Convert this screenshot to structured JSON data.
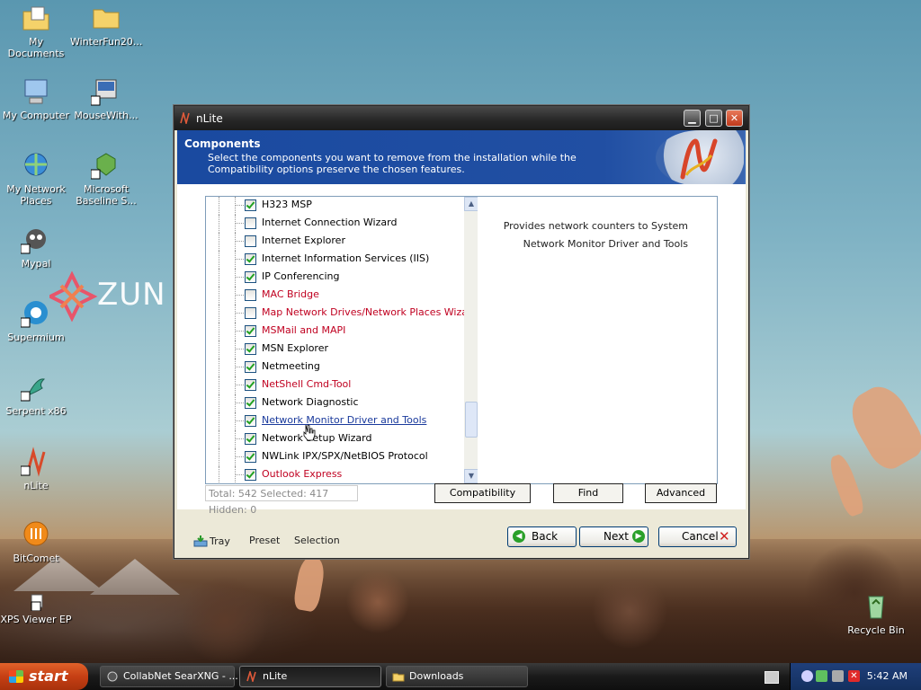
{
  "desktop": {
    "icons": [
      {
        "label": "My Documents",
        "icon": "folder-docs-icon"
      },
      {
        "label": "WinterFun20...",
        "icon": "folder-icon"
      },
      {
        "label": "My Computer",
        "icon": "computer-icon"
      },
      {
        "label": "MouseWith...",
        "icon": "program-icon"
      },
      {
        "label": "My Network Places",
        "icon": "network-icon"
      },
      {
        "label": "Microsoft Baseline S...",
        "icon": "mbsa-icon"
      },
      {
        "label": "Mypal",
        "icon": "mypal-icon"
      },
      {
        "label": "Supermium",
        "icon": "supermium-icon"
      },
      {
        "label": "Serpent x86",
        "icon": "serpent-icon"
      },
      {
        "label": "nLite",
        "icon": "nlite-icon"
      },
      {
        "label": "BitComet",
        "icon": "bitcomet-icon"
      },
      {
        "label": "XPS Viewer EP",
        "icon": "xps-icon"
      },
      {
        "label": "Recycle Bin",
        "icon": "recycle-bin-icon"
      }
    ],
    "wallpaper_brand": "ZUN"
  },
  "window": {
    "title": "nLite",
    "header_title": "Components",
    "header_desc": "Select the components you want to remove from the installation while the Compatibility options preserve the chosen features.",
    "tree_items": [
      {
        "label": "H323 MSP",
        "checked": true,
        "style": "normal"
      },
      {
        "label": "Internet Connection Wizard",
        "checked": false,
        "style": "normal"
      },
      {
        "label": "Internet Explorer",
        "checked": false,
        "style": "normal"
      },
      {
        "label": "Internet Information Services (IIS)",
        "checked": true,
        "style": "normal"
      },
      {
        "label": "IP Conferencing",
        "checked": true,
        "style": "normal"
      },
      {
        "label": "MAC Bridge",
        "checked": false,
        "style": "red"
      },
      {
        "label": "Map Network Drives/Network Places Wizard",
        "checked": false,
        "style": "red"
      },
      {
        "label": "MSMail and MAPI",
        "checked": true,
        "style": "red"
      },
      {
        "label": "MSN Explorer",
        "checked": true,
        "style": "normal"
      },
      {
        "label": "Netmeeting",
        "checked": true,
        "style": "normal"
      },
      {
        "label": "NetShell Cmd-Tool",
        "checked": true,
        "style": "red"
      },
      {
        "label": "Network Diagnostic",
        "checked": true,
        "style": "normal"
      },
      {
        "label": "Network Monitor Driver and Tools",
        "checked": true,
        "style": "link"
      },
      {
        "label": "Network Setup Wizard",
        "checked": true,
        "style": "normal"
      },
      {
        "label": "NWLink IPX/SPX/NetBIOS Protocol",
        "checked": true,
        "style": "normal"
      },
      {
        "label": "Outlook Express",
        "checked": true,
        "style": "red"
      }
    ],
    "description_lines": [
      "Provides network counters to System",
      "Network Monitor Driver and Tools"
    ],
    "status": "Total: 542 Selected: 417 Hidden: 0",
    "compatibility_label": "Compatibility",
    "find_label": "Find",
    "advanced_label": "Advanced",
    "tray_label": "Tray",
    "preset_label": "Preset",
    "selection_label": "Selection",
    "back_label": "Back",
    "next_label": "Next",
    "cancel_label": "Cancel"
  },
  "taskbar": {
    "start_label": "start",
    "tasks": [
      {
        "label": "CollabNet SearXNG - ...",
        "active": false
      },
      {
        "label": "nLite",
        "active": true
      },
      {
        "label": "Downloads",
        "active": false
      }
    ],
    "clock": "5:42 AM"
  },
  "colors": {
    "header_blue": "#214fa3",
    "red_item": "#c00020",
    "link_item": "#1a3a9c",
    "check_green": "#21a121"
  }
}
